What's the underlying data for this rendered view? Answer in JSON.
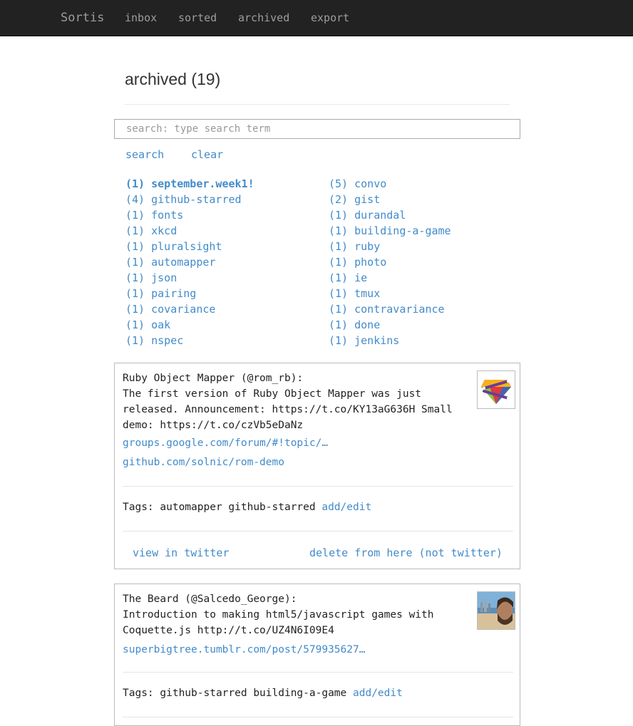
{
  "nav": {
    "brand": "Sortis",
    "links": [
      "inbox",
      "sorted",
      "archived",
      "export"
    ]
  },
  "page": {
    "title": "archived (19)"
  },
  "search": {
    "placeholder": "search: type search term",
    "value": "",
    "search_label": "search",
    "clear_label": "clear"
  },
  "tags_left": [
    "(1) september.week1!",
    "(4) github-starred",
    "(1) fonts",
    "(1) xkcd",
    "(1) pluralsight",
    "(1) automapper",
    "(1) json",
    "(1) pairing",
    "(1) covariance",
    "(1) oak",
    "(1) nspec"
  ],
  "tags_right": [
    "(5) convo",
    "(2) gist",
    "(1) durandal",
    "(1) building-a-game",
    "(1) ruby",
    "(1) photo",
    "(1) ie",
    "(1) tmux",
    "(1) contravariance",
    "(1) done",
    "(1) jenkins"
  ],
  "cards": [
    {
      "text": "Ruby Object Mapper (@rom_rb):\nThe first version of Ruby Object Mapper was just\nreleased. Announcement: https://t.co/KY13aG636H Small\ndemo: https://t.co/czVb5eDaNz",
      "links": [
        "groups.google.com/forum/#!topic/…",
        "github.com/solnic/rom-demo"
      ],
      "tags_label": "Tags: automapper github-starred",
      "add_edit": "add/edit",
      "view_label": "view in twitter",
      "delete_label": "delete from here (not twitter)",
      "avatar_icon": "rom-logo-icon"
    },
    {
      "text": "The Beard (@Salcedo_George):\nIntroduction to making html5/javascript games with\nCoquette.js http://t.co/UZ4N6I09E4",
      "links": [
        "superbigtree.tumblr.com/post/579935627…"
      ],
      "tags_label": "Tags: github-starred building-a-game",
      "add_edit": "add/edit",
      "avatar_icon": "user-photo-icon"
    }
  ],
  "colors": {
    "navbar": "#222222",
    "nav_text": "#9d9d9d",
    "link": "#428bca",
    "border": "#bbbbbb"
  }
}
